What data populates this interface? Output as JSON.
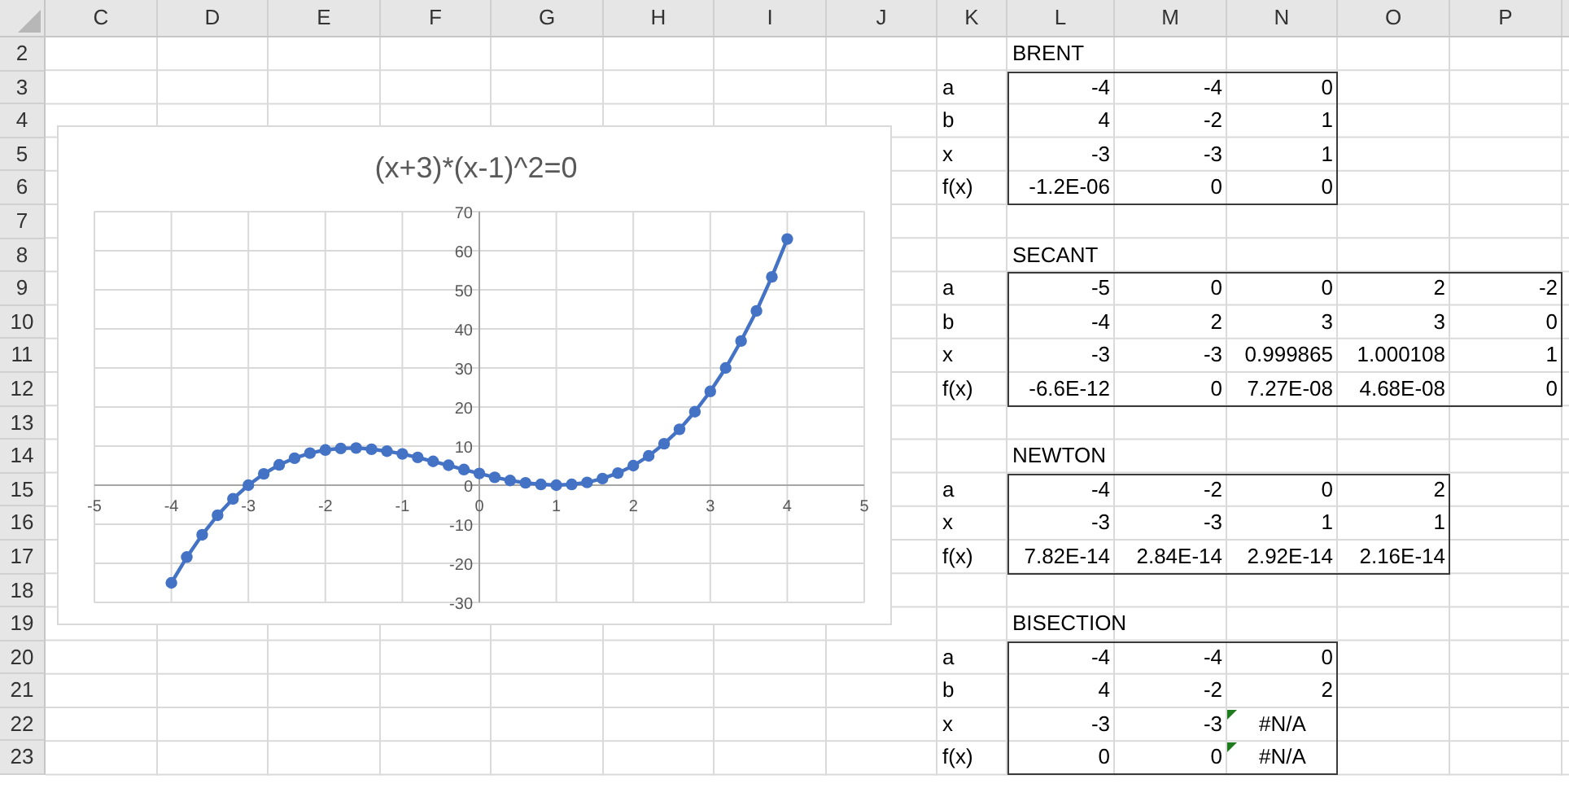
{
  "columns": [
    "C",
    "D",
    "E",
    "F",
    "G",
    "H",
    "I",
    "J",
    "K",
    "L",
    "M",
    "N",
    "O",
    "P"
  ],
  "rows": [
    "2",
    "3",
    "4",
    "5",
    "6",
    "7",
    "8",
    "9",
    "10",
    "11",
    "12",
    "13",
    "14",
    "15",
    "16",
    "17",
    "18",
    "19",
    "20",
    "21",
    "22",
    "23"
  ],
  "chart": {
    "chart_data": {
      "type": "line",
      "grid": true,
      "title": "(x+3)*(x-1)^2=0",
      "xlim": [
        -5,
        5
      ],
      "ylim": [
        -30,
        70
      ],
      "xticks": [
        -5,
        -4,
        -3,
        -2,
        -1,
        0,
        1,
        2,
        3,
        4,
        5
      ],
      "yticks": [
        -30,
        -20,
        -10,
        0,
        10,
        20,
        30,
        40,
        50,
        60,
        70
      ],
      "x": [
        -4,
        -3.8,
        -3.6,
        -3.4,
        -3.2,
        -3,
        -2.8,
        -2.6,
        -2.4,
        -2.2,
        -2,
        -1.8,
        -1.6,
        -1.4,
        -1.2,
        -1,
        -0.8,
        -0.6,
        -0.4,
        -0.2,
        0,
        0.2,
        0.4,
        0.6,
        0.8,
        1,
        1.2,
        1.4,
        1.6,
        1.8,
        2,
        2.2,
        2.4,
        2.6,
        2.8,
        3,
        3.2,
        3.4,
        3.6,
        3.8,
        4
      ],
      "series": [
        {
          "color": "#4472c4",
          "marker": "circle",
          "values": [
            -25,
            -18.4,
            -12.7,
            -7.7,
            -3.5,
            0,
            2.9,
            5.2,
            6.9,
            8.2,
            9,
            9.4,
            9.5,
            9.2,
            8.7,
            8,
            7.1,
            6.1,
            5.1,
            4,
            3,
            2,
            1.2,
            0.6,
            0.2,
            0,
            0.2,
            0.7,
            1.7,
            3.1,
            5,
            7.5,
            10.6,
            14.3,
            18.8,
            24,
            30,
            36.9,
            44.6,
            53.3,
            63
          ]
        }
      ]
    }
  },
  "tables": [
    {
      "title": "BRENT",
      "rows": [
        {
          "label": "a",
          "cells": [
            {
              "text": "-4",
              "kind": "number",
              "flag": false
            },
            {
              "text": "-4",
              "kind": "number",
              "flag": false
            },
            {
              "text": "0",
              "kind": "number",
              "flag": false
            }
          ]
        },
        {
          "label": "b",
          "cells": [
            {
              "text": "4",
              "kind": "number",
              "flag": false
            },
            {
              "text": "-2",
              "kind": "number",
              "flag": false
            },
            {
              "text": "1",
              "kind": "number",
              "flag": false
            }
          ]
        },
        {
          "label": "x",
          "cells": [
            {
              "text": "-3",
              "kind": "number",
              "flag": false
            },
            {
              "text": "-3",
              "kind": "number",
              "flag": false
            },
            {
              "text": "1",
              "kind": "number",
              "flag": false
            }
          ]
        },
        {
          "label": "f(x)",
          "cells": [
            {
              "text": "-1.2E-06",
              "kind": "number",
              "flag": false
            },
            {
              "text": "0",
              "kind": "number",
              "flag": false
            },
            {
              "text": "0",
              "kind": "number",
              "flag": false
            }
          ]
        }
      ]
    },
    {
      "title": "SECANT",
      "rows": [
        {
          "label": "a",
          "cells": [
            {
              "text": "-5",
              "kind": "number",
              "flag": false
            },
            {
              "text": "0",
              "kind": "number",
              "flag": false
            },
            {
              "text": "0",
              "kind": "number",
              "flag": false
            },
            {
              "text": "2",
              "kind": "number",
              "flag": false
            },
            {
              "text": "-2",
              "kind": "number",
              "flag": false
            }
          ]
        },
        {
          "label": "b",
          "cells": [
            {
              "text": "-4",
              "kind": "number",
              "flag": false
            },
            {
              "text": "2",
              "kind": "number",
              "flag": false
            },
            {
              "text": "3",
              "kind": "number",
              "flag": false
            },
            {
              "text": "3",
              "kind": "number",
              "flag": false
            },
            {
              "text": "0",
              "kind": "number",
              "flag": false
            }
          ]
        },
        {
          "label": "x",
          "cells": [
            {
              "text": "-3",
              "kind": "number",
              "flag": false
            },
            {
              "text": "-3",
              "kind": "number",
              "flag": false
            },
            {
              "text": "0.999865",
              "kind": "number",
              "flag": false
            },
            {
              "text": "1.000108",
              "kind": "number",
              "flag": false
            },
            {
              "text": "1",
              "kind": "number",
              "flag": false
            }
          ]
        },
        {
          "label": "f(x)",
          "cells": [
            {
              "text": "-6.6E-12",
              "kind": "number",
              "flag": false
            },
            {
              "text": "0",
              "kind": "number",
              "flag": false
            },
            {
              "text": "7.27E-08",
              "kind": "number",
              "flag": false
            },
            {
              "text": "4.68E-08",
              "kind": "number",
              "flag": false
            },
            {
              "text": "0",
              "kind": "number",
              "flag": false
            }
          ]
        }
      ]
    },
    {
      "title": "NEWTON",
      "rows": [
        {
          "label": "a",
          "cells": [
            {
              "text": "-4",
              "kind": "number",
              "flag": false
            },
            {
              "text": "-2",
              "kind": "number",
              "flag": false
            },
            {
              "text": "0",
              "kind": "number",
              "flag": false
            },
            {
              "text": "2",
              "kind": "number",
              "flag": false
            }
          ]
        },
        {
          "label": "x",
          "cells": [
            {
              "text": "-3",
              "kind": "number",
              "flag": false
            },
            {
              "text": "-3",
              "kind": "number",
              "flag": false
            },
            {
              "text": "1",
              "kind": "number",
              "flag": false
            },
            {
              "text": "1",
              "kind": "number",
              "flag": false
            }
          ]
        },
        {
          "label": "f(x)",
          "cells": [
            {
              "text": "7.82E-14",
              "kind": "number",
              "flag": false
            },
            {
              "text": "2.84E-14",
              "kind": "number",
              "flag": false
            },
            {
              "text": "2.92E-14",
              "kind": "number",
              "flag": false
            },
            {
              "text": "2.16E-14",
              "kind": "number",
              "flag": false
            }
          ]
        }
      ]
    },
    {
      "title": "BISECTION",
      "rows": [
        {
          "label": "a",
          "cells": [
            {
              "text": "-4",
              "kind": "number",
              "flag": false
            },
            {
              "text": "-4",
              "kind": "number",
              "flag": false
            },
            {
              "text": "0",
              "kind": "number",
              "flag": false
            }
          ]
        },
        {
          "label": "b",
          "cells": [
            {
              "text": "4",
              "kind": "number",
              "flag": false
            },
            {
              "text": "-2",
              "kind": "number",
              "flag": false
            },
            {
              "text": "2",
              "kind": "number",
              "flag": false
            }
          ]
        },
        {
          "label": "x",
          "cells": [
            {
              "text": "-3",
              "kind": "number",
              "flag": false
            },
            {
              "text": "-3",
              "kind": "number",
              "flag": false
            },
            {
              "text": "#N/A",
              "kind": "error",
              "flag": true
            }
          ]
        },
        {
          "label": "f(x)",
          "cells": [
            {
              "text": "0",
              "kind": "number",
              "flag": false
            },
            {
              "text": "0",
              "kind": "number",
              "flag": false
            },
            {
              "text": "#N/A",
              "kind": "error",
              "flag": true
            }
          ]
        }
      ]
    }
  ]
}
